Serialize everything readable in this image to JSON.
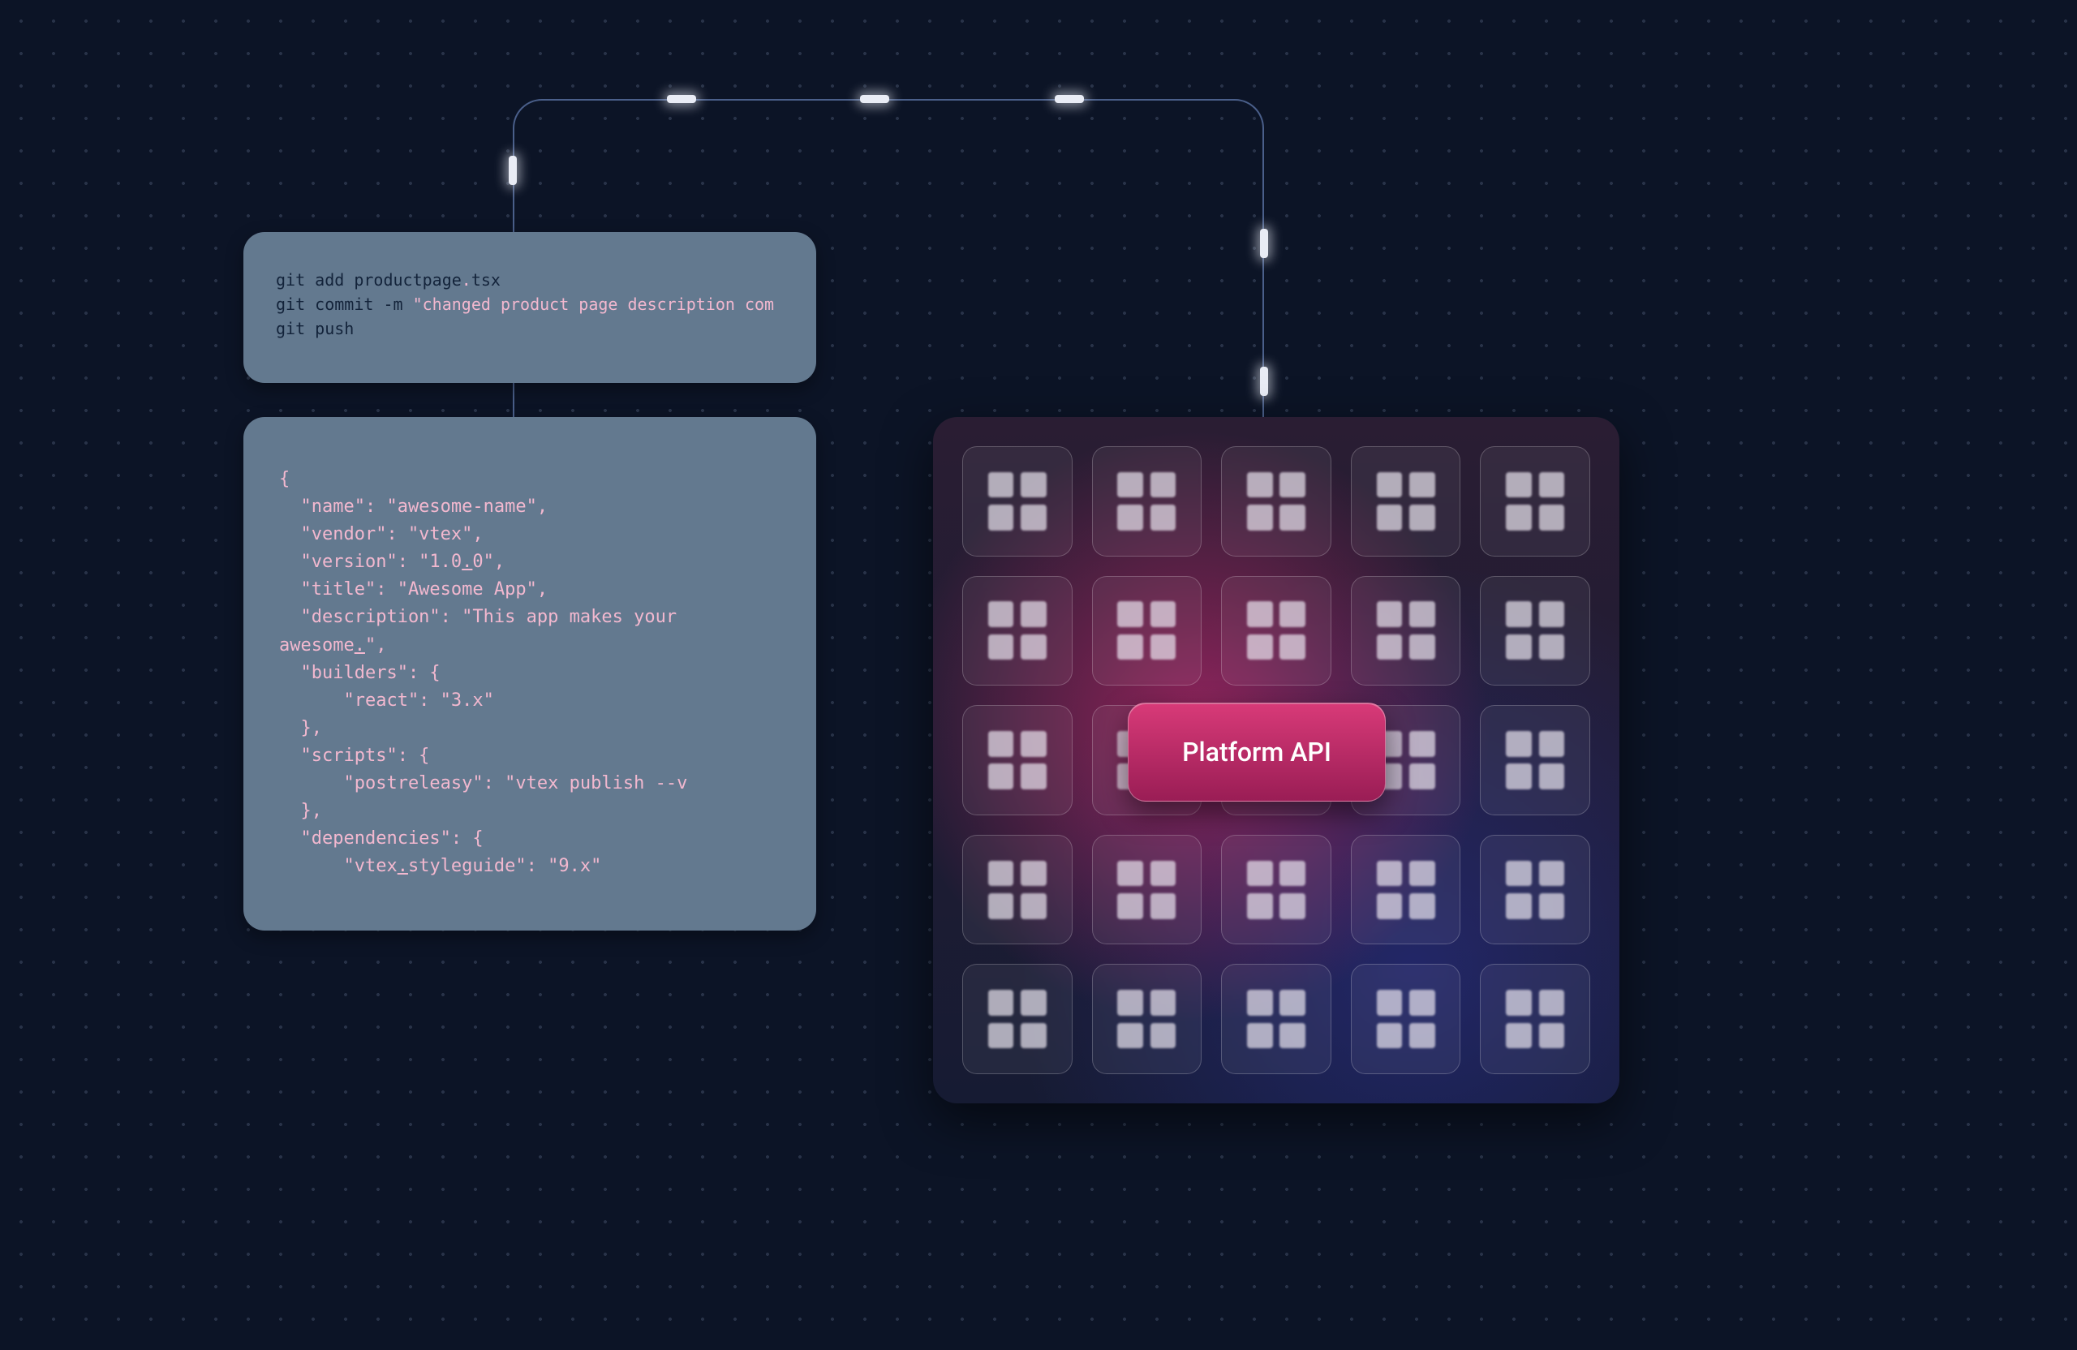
{
  "terminal": {
    "line1_pre": "git add productpage",
    "line1_dot": ".",
    "line1_post": "tsx",
    "line2_pre": "git commit -m ",
    "line2_str": "\"changed product page description com",
    "line3": "git push"
  },
  "manifest": {
    "open": "{",
    "l_name": "  \"name\": \"awesome-name\",",
    "l_vendor": "  \"vendor\": \"vtex\",",
    "l_version_a": "  \"version\": \"1.0",
    "l_version_u": ".",
    "l_version_b": "0\",",
    "l_title": "  \"title\": \"Awesome App\",",
    "l_desc1": "  \"description\": \"This app makes your",
    "l_desc2_a": "awesome",
    "l_desc2_u": ".",
    "l_desc2_b": "\",",
    "l_builders_o": "  \"builders\": {",
    "l_react": "      \"react\": \"3.x\"",
    "l_builders_c": "  },",
    "l_scripts_o": "  \"scripts\": {",
    "l_postr": "      \"postreleasy\": \"vtex publish --v",
    "l_scripts_c": "  },",
    "l_deps_o": "  \"dependencies\": {",
    "l_sg_a": "      \"vtex",
    "l_sg_u": ".",
    "l_sg_b": "styleguide\": \"9.x\""
  },
  "api_label": "Platform API",
  "colors": {
    "bg": "#0c1426",
    "card": "#63798f",
    "string": "#f2b8cf",
    "accent": "#d83a78"
  }
}
